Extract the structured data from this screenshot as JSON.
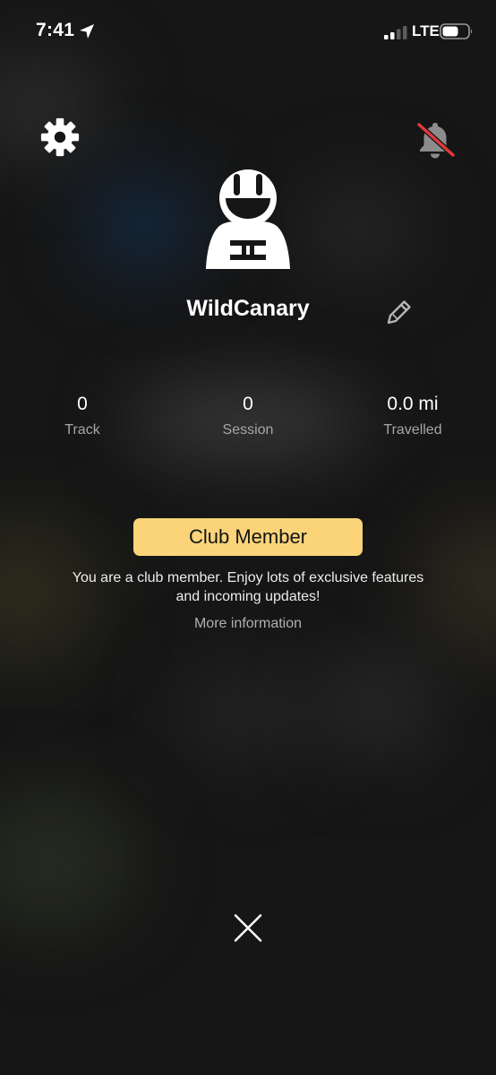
{
  "status_bar": {
    "time": "7:41",
    "network": "LTE"
  },
  "profile": {
    "username": "WildCanary"
  },
  "stats": [
    {
      "value": "0",
      "label": "Track"
    },
    {
      "value": "0",
      "label": "Session"
    },
    {
      "value": "0.0 mi",
      "label": "Travelled"
    }
  ],
  "club": {
    "button_label": "Club Member",
    "description": "You are a club member. Enjoy lots of exclusive features and incoming updates!",
    "more_info": "More information"
  },
  "colors": {
    "accent": "#fbd47a",
    "muted_bell_slash": "#e03a3a",
    "background": "#161616"
  },
  "icons": {
    "settings": "gear-icon",
    "notifications": "bell-slash-icon",
    "avatar": "rider-helmet-icon",
    "edit": "pencil-icon",
    "close": "close-icon"
  }
}
